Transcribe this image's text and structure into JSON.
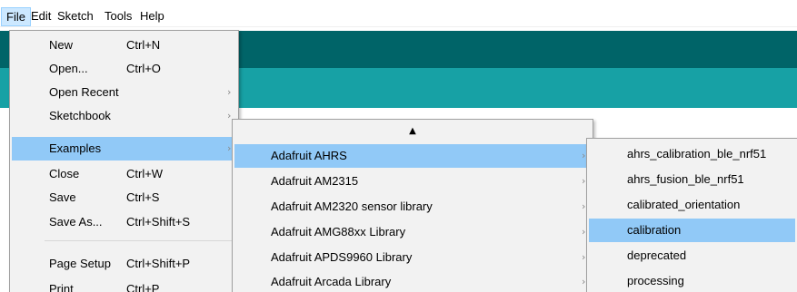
{
  "menubar": {
    "items": [
      "File",
      "Edit",
      "Sketch",
      "Tools",
      "Help"
    ]
  },
  "file_menu": {
    "items": [
      {
        "label": "New",
        "shortcut": "Ctrl+N",
        "submenu": false
      },
      {
        "label": "Open...",
        "shortcut": "Ctrl+O",
        "submenu": false
      },
      {
        "label": "Open Recent",
        "shortcut": "",
        "submenu": true
      },
      {
        "label": "Sketchbook",
        "shortcut": "",
        "submenu": true
      },
      {
        "label": "Examples",
        "shortcut": "",
        "submenu": true
      },
      {
        "label": "Close",
        "shortcut": "Ctrl+W",
        "submenu": false
      },
      {
        "label": "Save",
        "shortcut": "Ctrl+S",
        "submenu": false
      },
      {
        "label": "Save As...",
        "shortcut": "Ctrl+Shift+S",
        "submenu": false
      },
      {
        "label": "Page Setup",
        "shortcut": "Ctrl+Shift+P",
        "submenu": false
      },
      {
        "label": "Print",
        "shortcut": "Ctrl+P",
        "submenu": false
      }
    ]
  },
  "examples_menu": {
    "scroll_up_glyph": "▲",
    "items": [
      {
        "label": "Adafruit AHRS",
        "submenu": true
      },
      {
        "label": "Adafruit AM2315",
        "submenu": true
      },
      {
        "label": "Adafruit AM2320 sensor library",
        "submenu": true
      },
      {
        "label": "Adafruit AMG88xx Library",
        "submenu": true
      },
      {
        "label": "Adafruit APDS9960 Library",
        "submenu": true
      },
      {
        "label": "Adafruit Arcada Library",
        "submenu": true
      }
    ]
  },
  "ahrs_menu": {
    "items": [
      {
        "label": "ahrs_calibration_ble_nrf51"
      },
      {
        "label": "ahrs_fusion_ble_nrf51"
      },
      {
        "label": "calibrated_orientation"
      },
      {
        "label": "calibration"
      },
      {
        "label": "deprecated"
      },
      {
        "label": "processing"
      }
    ]
  },
  "glyphs": {
    "submenu_arrow": "›"
  },
  "colors": {
    "header_dark": "#006468",
    "header_teal": "#17a1a5",
    "menu_highlight": "#91c9f7",
    "menubar_active": "#cce8ff"
  }
}
